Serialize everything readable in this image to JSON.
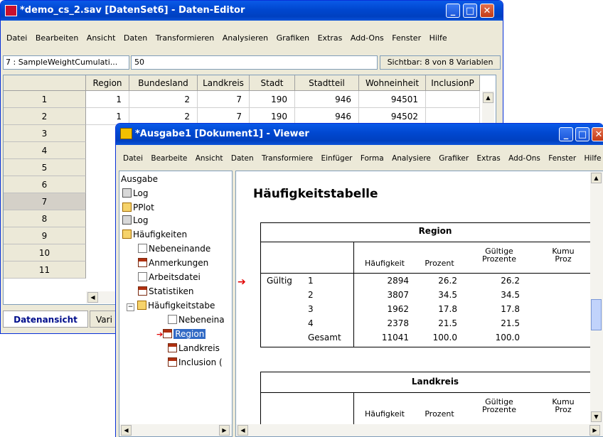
{
  "data_editor": {
    "title": "*demo_cs_2.sav [DatenSet6] - Daten-Editor",
    "menu": [
      "Datei",
      "Bearbeiten",
      "Ansicht",
      "Daten",
      "Transformieren",
      "Analysieren",
      "Grafiken",
      "Extras",
      "Add-Ons",
      "Fenster",
      "Hilfe"
    ],
    "cell_ref": "7 : SampleWeightCumulati...",
    "cell_value": "50",
    "visible_info": "Sichtbar: 8 von 8 Variablen",
    "columns": [
      "Region",
      "Bundesland",
      "Landkreis",
      "Stadt",
      "Stadtteil",
      "Wohneinheit",
      "InclusionP"
    ],
    "row_numbers": [
      "1",
      "2",
      "3",
      "4",
      "5",
      "6",
      "7",
      "8",
      "9",
      "10",
      "11"
    ],
    "rows": [
      [
        "1",
        "2",
        "7",
        "190",
        "946",
        "94501",
        ""
      ],
      [
        "1",
        "2",
        "7",
        "190",
        "946",
        "94502",
        ""
      ]
    ],
    "tabs": [
      "Datenansicht",
      "Vari"
    ]
  },
  "viewer": {
    "title": "*Ausgabe1 [Dokument1] - Viewer",
    "menu": [
      "Datei",
      "Bearbeite",
      "Ansicht",
      "Daten",
      "Transformiere",
      "Einfüger",
      "Forma",
      "Analysiere",
      "Grafiker",
      "Extras",
      "Add-Ons",
      "Fenster",
      "Hilfe"
    ],
    "tree": {
      "root": "Ausgabe",
      "log1": "Log",
      "pplot": "PPlot",
      "log2": "Log",
      "haeufigkeiten": "Häufigkeiten",
      "nebeneinander": "Nebeneinande",
      "anmerkungen": "Anmerkungen",
      "arbeitsdatei": "Arbeitsdatei",
      "statistiken": "Statistiken",
      "haeufigkeitstabelle": "Häufigkeitstabe",
      "nebeneinander2": "Nebeneina",
      "region": "Region",
      "landkreis": "Landkreis",
      "inclusion": "Inclusion ("
    },
    "heading": "Häufigkeitstabelle",
    "table1": {
      "title": "Region",
      "col_headers": [
        "Häufigkeit",
        "Prozent",
        "Gültige Prozente",
        "Kumu Proz"
      ],
      "group_label": "Gültig",
      "rows": [
        {
          "label": "1",
          "freq": "2894",
          "pct": "26.2",
          "valid": "26.2"
        },
        {
          "label": "2",
          "freq": "3807",
          "pct": "34.5",
          "valid": "34.5"
        },
        {
          "label": "3",
          "freq": "1962",
          "pct": "17.8",
          "valid": "17.8"
        },
        {
          "label": "4",
          "freq": "2378",
          "pct": "21.5",
          "valid": "21.5"
        },
        {
          "label": "Gesamt",
          "freq": "11041",
          "pct": "100.0",
          "valid": "100.0"
        }
      ]
    },
    "table2": {
      "title": "Landkreis",
      "col_headers": [
        "Häufigkeit",
        "Prozent",
        "Gültige Prozente",
        "Kumu Proz"
      ]
    }
  },
  "colors": {
    "titlebar": "#0047cf",
    "marker_arrow": "#e00000"
  }
}
